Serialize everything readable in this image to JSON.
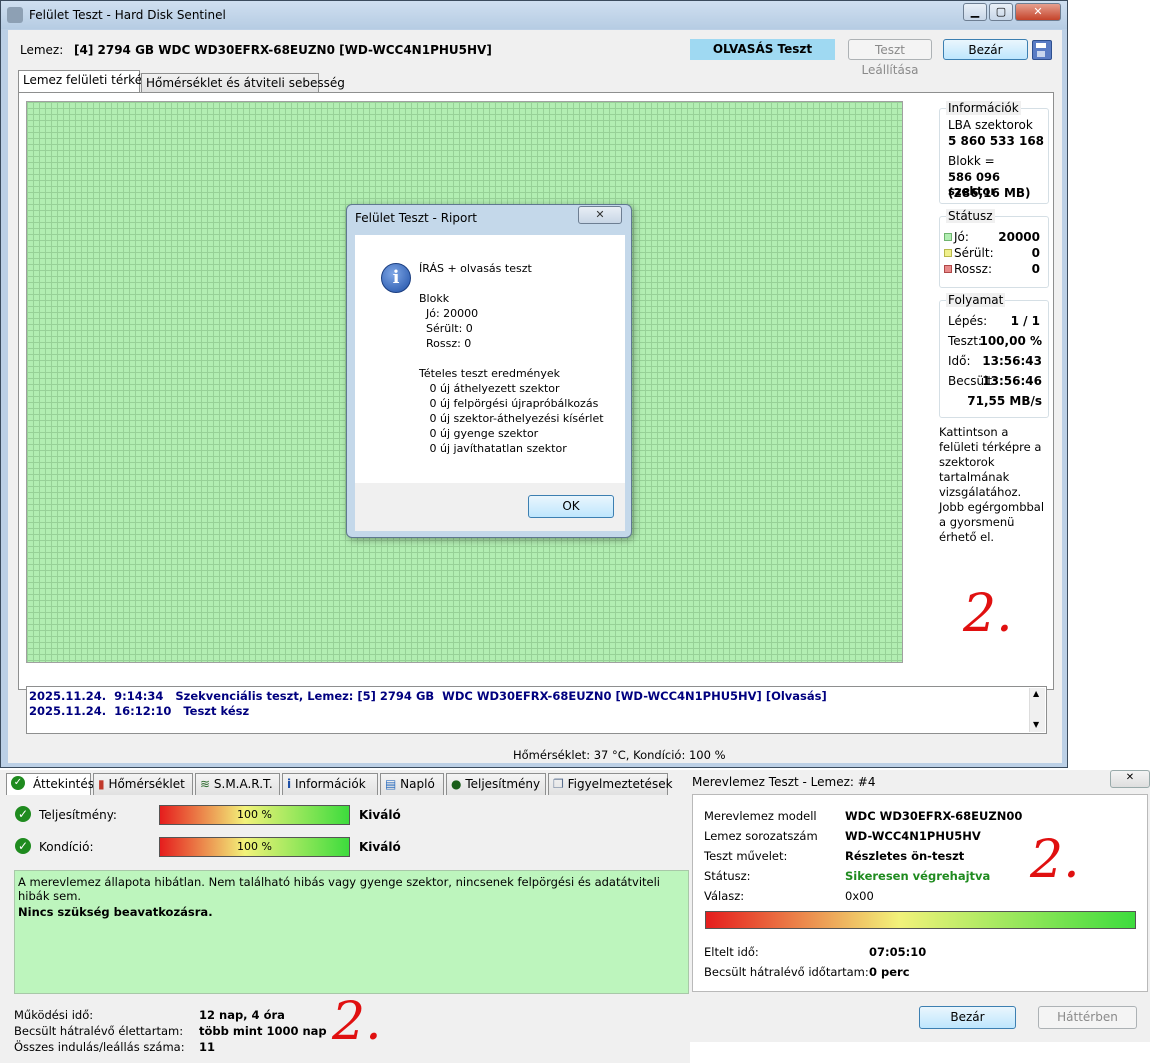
{
  "main": {
    "title": "Felület Teszt - Hard Disk Sentinel",
    "disk_label": "Lemez:",
    "disk_value": "[4] 2794 GB  WDC WD30EFRX-68EUZN0 [WD-WCC4N1PHU5HV]",
    "mode_label": "OLVASÁS Teszt",
    "stop_label": "Teszt Leállítása",
    "close_label": "Bezár",
    "tabs": [
      "Lemez felületi térkép",
      "Hőmérséklet és átviteli sebesség"
    ],
    "info": {
      "title": "Információk",
      "lba_label": "LBA szektorok",
      "lba_value": "5 860 533 168",
      "block_label": "Blokk =",
      "block_value": "586 096 szektor",
      "block_size": "(286,16 MB)"
    },
    "status": {
      "title": "Státusz",
      "good_label": "Jó:",
      "good_value": "20000",
      "damaged_label": "Sérült:",
      "damaged_value": "0",
      "bad_label": "Rossz:",
      "bad_value": "0"
    },
    "progress": {
      "title": "Folyamat",
      "step_label": "Lépés:",
      "step_value": "1 / 1",
      "test_label": "Teszt:",
      "test_value": "100,00 %",
      "time_label": "Idő:",
      "time_value": "13:56:43",
      "est_label": "Becsült:",
      "est_value": "13:56:46",
      "speed": "71,55 MB/s"
    },
    "hint1": "Kattintson a felületi térképre a szektorok tartalmának vizsgálatához.",
    "hint2": "Jobb egérgombbal a gyorsmenü érhető el.",
    "log": [
      "2025.11.24.  9:14:34   Szekvenciális teszt, Lemez: [5] 2794 GB  WDC WD30EFRX-68EUZN0 [WD-WCC4N1PHU5HV] [Olvasás]",
      "2025.11.24.  16:12:10   Teszt kész"
    ],
    "statusbar": "Hőmérséklet: 37  °C,  Kondíció: 100 %"
  },
  "dialog": {
    "title": "Felület Teszt - Riport",
    "body": "ÍRÁS + olvasás teszt\n\nBlokk\n  Jó: 20000\n  Sérült: 0\n  Rossz: 0\n\nTételes teszt eredmények\n   0 új áthelyezett szektor\n   0 új felpörgési újrapróbálkozás\n   0 új szektor-áthelyezési kísérlet\n   0 új gyenge szektor\n   0 új javíthatatlan szektor",
    "ok_label": "OK"
  },
  "overview": {
    "tabs": [
      "Áttekintés",
      "Hőmérséklet",
      "S.M.A.R.T.",
      "Információk",
      "Napló",
      "Teljesítmény",
      "Figyelmeztetések"
    ],
    "perf_label": "Teljesítmény:",
    "perf_bar": "100 %",
    "perf_value": 100,
    "perf_rating": "Kiváló",
    "cond_label": "Kondíció:",
    "cond_bar": "100 %",
    "cond_value": 100,
    "cond_rating": "Kiváló",
    "message": "A merevlemez állapota hibátlan. Nem található hibás vagy gyenge szektor, nincsenek felpörgési és adatátviteli hibák sem.",
    "advice": "Nincs szükség beavatkozásra.",
    "uptime_label": "Működési idő:",
    "uptime_value": "12 nap, 4 óra",
    "life_label": "Becsült hátralévő élettartam:",
    "life_value": "több mint 1000 nap",
    "starts_label": "Összes indulás/leállás száma:",
    "starts_value": "11"
  },
  "hdtest": {
    "title": "Merevlemez Teszt - Lemez: #4",
    "model_label": "Merevlemez modell",
    "model_value": "WDC WD30EFRX-68EUZN00",
    "serial_label": "Lemez sorozatszám",
    "serial_value": "WD-WCC4N1PHU5HV",
    "op_label": "Teszt művelet:",
    "op_value": "Részletes ön-teszt",
    "status_label": "Státusz:",
    "status_value": "Sikeresen végrehajtva",
    "resp_label": "Válasz:",
    "resp_value": "0x00",
    "elapsed_label": "Eltelt idő:",
    "elapsed_value": "07:05:10",
    "remain_label": "Becsült hátralévő időtartam:",
    "remain_value": "0 perc",
    "close_label": "Bezár",
    "bg_label": "Háttérben",
    "progress_value": 100
  },
  "annotations": [
    "2.",
    "2.",
    "2."
  ],
  "colors": {
    "grid_good": "#b2eeb2",
    "ok_green": "#1f8b1f",
    "log_blue": "#00007f"
  }
}
